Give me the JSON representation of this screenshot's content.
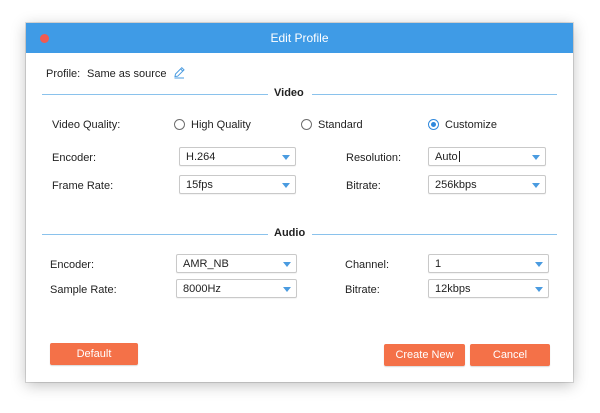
{
  "window": {
    "title": "Edit Profile"
  },
  "profile": {
    "label": "Profile:",
    "value": "Same as source"
  },
  "video": {
    "section_title": "Video",
    "quality_label": "Video Quality:",
    "quality_options": [
      {
        "label": "High Quality",
        "selected": false
      },
      {
        "label": "Standard",
        "selected": false
      },
      {
        "label": "Customize",
        "selected": true
      }
    ],
    "encoder_label": "Encoder:",
    "encoder_value": "H.264",
    "resolution_label": "Resolution:",
    "resolution_value": "Auto",
    "frame_rate_label": "Frame Rate:",
    "frame_rate_value": "15fps",
    "bitrate_label": "Bitrate:",
    "bitrate_value": "256kbps"
  },
  "audio": {
    "section_title": "Audio",
    "encoder_label": "Encoder:",
    "encoder_value": "AMR_NB",
    "channel_label": "Channel:",
    "channel_value": "1",
    "sample_rate_label": "Sample Rate:",
    "sample_rate_value": "8000Hz",
    "bitrate_label": "Bitrate:",
    "bitrate_value": "12kbps"
  },
  "buttons": {
    "default": "Default",
    "create_new": "Create New",
    "cancel": "Cancel"
  },
  "colors": {
    "titlebar": "#3f9be6",
    "close": "#ef5a52",
    "button": "#f47148",
    "accent": "#2f88dc",
    "section_line": "#8ac2ec"
  }
}
